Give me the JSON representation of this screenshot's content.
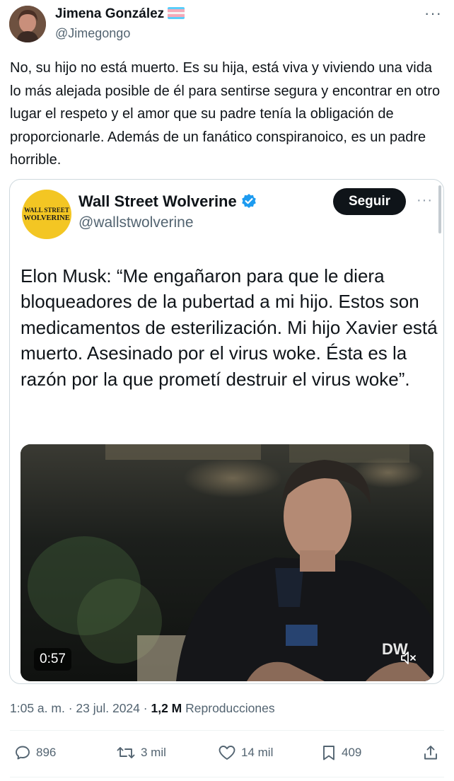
{
  "author": {
    "name": "Jimena González",
    "handle": "@Jimegongo",
    "flag_colors": [
      "#5bcefa",
      "#f5a9b8",
      "#ffffff",
      "#f5a9b8",
      "#5bcefa"
    ]
  },
  "tweet": {
    "text": "No, su hijo no está muerto. Es su hija, está viva y viviendo una vida lo más alejada posible de él para sentirse segura y encontrar en otro lugar el respeto y el amor que su padre tenía la obligación de proporcionarle. Además de un fanático conspiranoico, es un padre horrible."
  },
  "quote": {
    "avatar_line1": "WALL STREET",
    "avatar_line2": "WOLVERINE",
    "name": "Wall Street Wolverine",
    "handle": "@wallstwolverine",
    "follow_label": "Seguir",
    "text": "Elon Musk: “Me engañaron para que le diera bloqueadores de la pubertad a mi hijo. Estos son medicamentos de esterilización. Mi hijo Xavier está muerto. Asesinado por el virus woke. Ésta es la razón por la que prometí destruir el virus woke”.",
    "video": {
      "duration": "0:57",
      "watermark": "DW"
    }
  },
  "meta": {
    "time": "1:05 a. m.",
    "sep1": "·",
    "date": "23 jul. 2024",
    "sep2": "·",
    "views": "1,2 M",
    "views_label": "Reproducciones"
  },
  "actions": {
    "replies": "896",
    "reposts": "3 mil",
    "likes": "14 mil",
    "bookmarks": "409"
  },
  "colors": {
    "text": "#0f1419",
    "secondary": "#536471",
    "verified": "#1d9bf0",
    "border": "#cfd9de"
  }
}
